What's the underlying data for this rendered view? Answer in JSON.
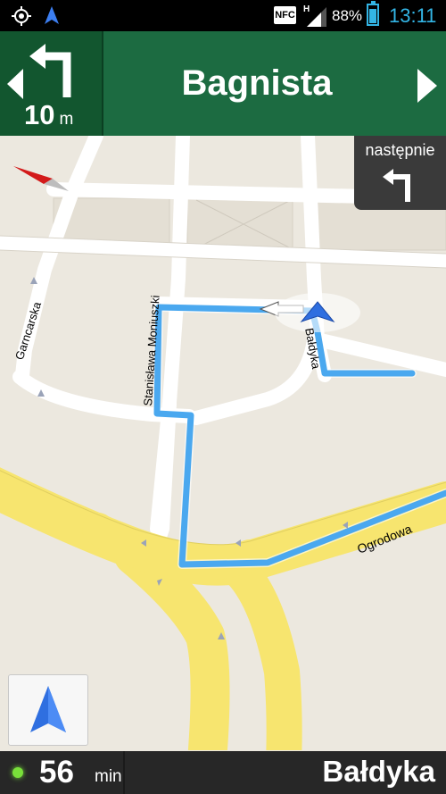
{
  "status_bar": {
    "nfc_label": "NFC",
    "network_type": "H",
    "battery_percent": "88%",
    "battery_level": 0.88,
    "time": "13:11",
    "icons": [
      "gps-icon",
      "navigation-mini-icon",
      "nfc-icon",
      "signal-icon",
      "battery-icon"
    ]
  },
  "navigation": {
    "current_distance": "10",
    "distance_unit": "m",
    "current_street": "Bagnista",
    "next_label": "następnie",
    "turn_icon": "turn-left-icon",
    "next_turn_icon": "turn-left-icon"
  },
  "map": {
    "street_labels": {
      "garncarska": "Garncarska",
      "moniuszki": "Stanisława Moniuszki",
      "baldyka": "Bałdyka",
      "ogrodowa": "Ogrodowa"
    },
    "colors": {
      "background": "#ece8df",
      "road": "#ffffff",
      "major_road": "#f7e56f",
      "route": "#4aa8ef",
      "header": "#1c6b41",
      "header_dark": "#12562f"
    }
  },
  "bottom_bar": {
    "eta_value": "56",
    "eta_unit": "min",
    "destination": "Bałdyka"
  }
}
